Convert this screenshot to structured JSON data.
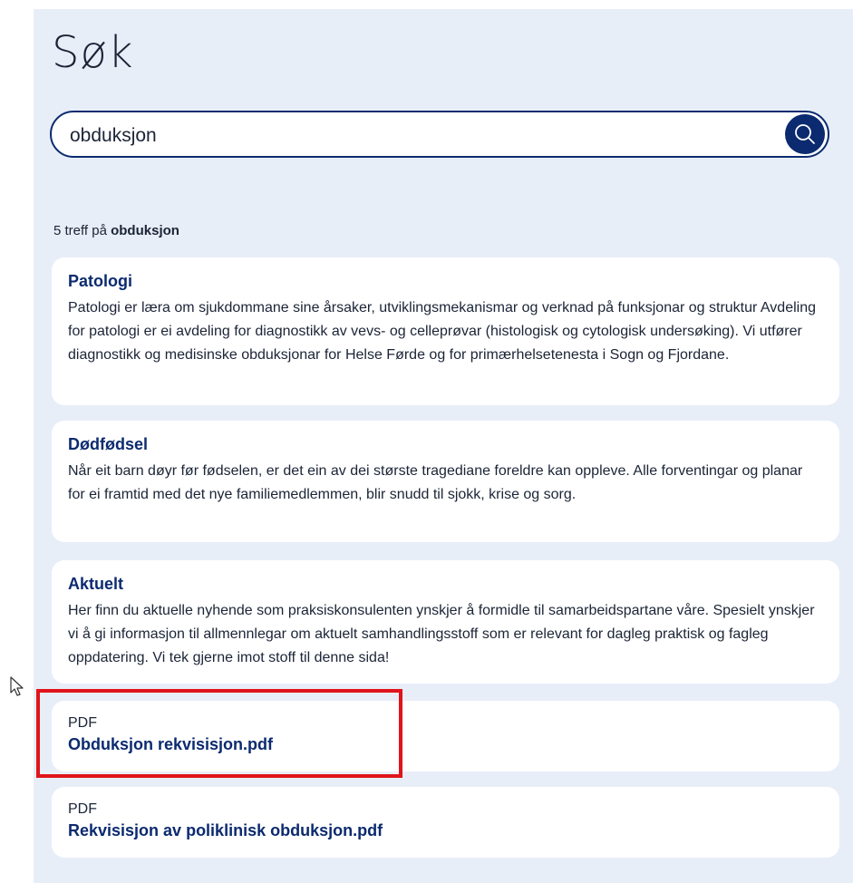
{
  "page": {
    "title": "Søk"
  },
  "search": {
    "value": "obduksjon",
    "button_icon": "search-icon"
  },
  "results_count": {
    "number": "5",
    "text": "treff på",
    "query": "obduksjon"
  },
  "results": [
    {
      "title": "Patologi",
      "text": "Patologi er læra om sjukdommane sine årsaker, utviklingsmekanismar og verknad på funksjonar og struktur Avdeling for patologi er ei avdeling for diagnostikk av vevs- og celleprøvar (histologisk og cytologisk undersøking). Vi utfører diagnostikk og medisinske obduksjonar for Helse Førde og for primærhelsetenesta i Sogn og Fjordane."
    },
    {
      "title": "Dødfødsel",
      "text": "Når eit barn døyr før fødselen, er det ein av dei største tragediane foreldre kan oppleve. Alle forventingar og planar for ei framtid med det nye familiemedlemmen, blir snudd til sjokk, krise og sorg."
    },
    {
      "title": "Aktuelt",
      "text": "Her finn du aktuelle nyhende som praksiskonsulenten ynskjer å formidle til samarbeidspartane våre. Spesielt ynskjer vi å gi informasjon til allmennlegar om aktuelt samhandlingsstoff som er relevant for dagleg praktisk og fagleg oppdatering. Vi tek gjerne imot stoff til denne sida!"
    }
  ],
  "files": [
    {
      "type": "PDF",
      "name": "Obduksjon rekvisisjon.pdf"
    },
    {
      "type": "PDF",
      "name": "Rekvisisjon av poliklinisk obduksjon.pdf"
    }
  ],
  "colors": {
    "brand": "#0b2a6f",
    "panel": "#e8eef8",
    "highlight": "#e0141a"
  }
}
